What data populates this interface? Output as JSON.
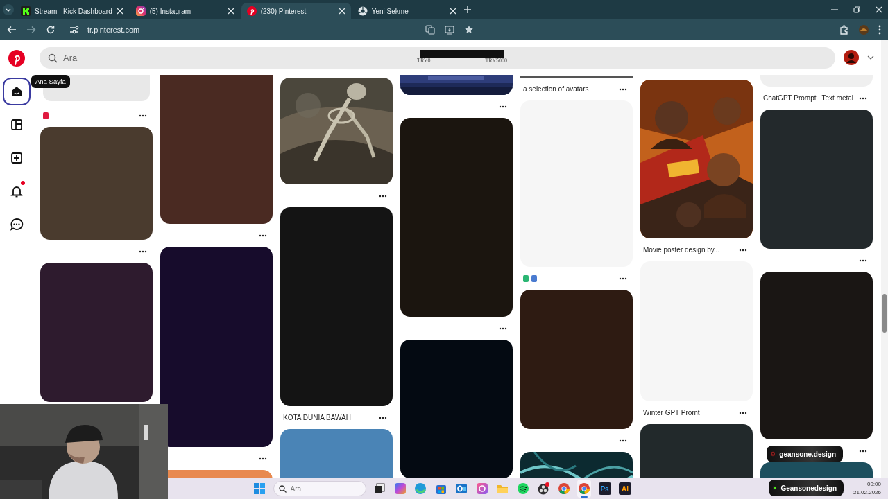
{
  "browser": {
    "tabs": [
      {
        "title": "Stream - Kick Dashboard",
        "kind": "kick",
        "selected": false
      },
      {
        "title": "(5) Instagram",
        "kind": "instagram",
        "selected": false
      },
      {
        "title": "(230) Pinterest",
        "kind": "pinterest",
        "selected": true
      },
      {
        "title": "Yeni Sekme",
        "kind": "chrome",
        "selected": false
      }
    ],
    "url": "tr.pinterest.com"
  },
  "sidebar": {
    "items": [
      {
        "kind": "home",
        "selected": true
      },
      {
        "kind": "boards",
        "selected": false
      },
      {
        "kind": "create",
        "selected": false
      },
      {
        "kind": "notifications",
        "selected": false,
        "unread": true
      },
      {
        "kind": "messages",
        "selected": false
      }
    ],
    "tooltip": "Ana Sayfa"
  },
  "search": {
    "placeholder": "Ara"
  },
  "donation_goal": {
    "start": "TRY0",
    "end": "TRY5000",
    "level": 0.01
  },
  "pin_columns": [
    [
      {
        "kind": "picture",
        "source_icons": [
          {
            "color": "#e0193f"
          }
        ]
      },
      {
        "kind": "color",
        "color": "#4a3b2e"
      },
      {
        "kind": "color",
        "color": "#2e1b2e"
      }
    ],
    [
      {
        "kind": "color",
        "color": "#4a2a22"
      },
      {
        "kind": "color",
        "color": "#170c2c"
      },
      {
        "kind": "color",
        "color": "#e8894f"
      }
    ],
    [
      {
        "kind": "picture"
      },
      {
        "kind": "color",
        "color": "#141414",
        "caption": "KOTA DUNIA BAWAH"
      },
      {
        "kind": "color",
        "color": "#4a84b6"
      }
    ],
    [
      {
        "kind": "picture"
      },
      {
        "kind": "color",
        "color": "#1b150f"
      },
      {
        "kind": "color",
        "color": "#040a12"
      }
    ],
    [
      {
        "kind": "color",
        "color": "#555555",
        "caption": "a selection of avatars"
      },
      {
        "kind": "color",
        "color": "#f6f6f6",
        "source_icons": [
          {
            "color": "#2bb673"
          },
          {
            "color": "#4a7bd0"
          }
        ]
      },
      {
        "kind": "color",
        "color": "#2e1b12"
      },
      {
        "kind": "picture"
      }
    ],
    [
      {
        "kind": "picture",
        "caption": "Movie poster design by..."
      },
      {
        "kind": "color",
        "color": "#f6f6f6",
        "caption": "Winter GPT Promt"
      },
      {
        "kind": "color",
        "color": "#22292b"
      }
    ],
    [
      {
        "kind": "color",
        "color": "#efefef",
        "caption": "ChatGPT Prompt | Text metal"
      },
      {
        "kind": "color",
        "color": "#23292c"
      },
      {
        "kind": "color",
        "color": "#1a1614"
      },
      {
        "kind": "color",
        "color": "#1d4f5e"
      }
    ]
  ],
  "overlays": {
    "chat_badge": "geansone.design",
    "channel_badge": "Geansonedesign"
  },
  "taskbar": {
    "apps": [
      {
        "kind": "start",
        "selected": false
      },
      {
        "kind": "search",
        "placeholder": "Ara"
      },
      {
        "kind": "taskview",
        "selected": false
      },
      {
        "kind": "copilot",
        "selected": false
      },
      {
        "kind": "edge",
        "selected": false
      },
      {
        "kind": "store",
        "selected": false
      },
      {
        "kind": "outlook",
        "selected": false
      },
      {
        "kind": "photos",
        "selected": false
      },
      {
        "kind": "files",
        "selected": false
      },
      {
        "kind": "spotify",
        "selected": false
      },
      {
        "kind": "obs",
        "selected": false
      },
      {
        "kind": "chrome",
        "selected": false
      },
      {
        "kind": "chrome",
        "selected": true
      },
      {
        "kind": "photoshop",
        "label": "Ps",
        "selected": false
      },
      {
        "kind": "illustrator",
        "label": "Ai",
        "selected": false
      }
    ],
    "time": "00:00",
    "date": "21.02.2026"
  }
}
